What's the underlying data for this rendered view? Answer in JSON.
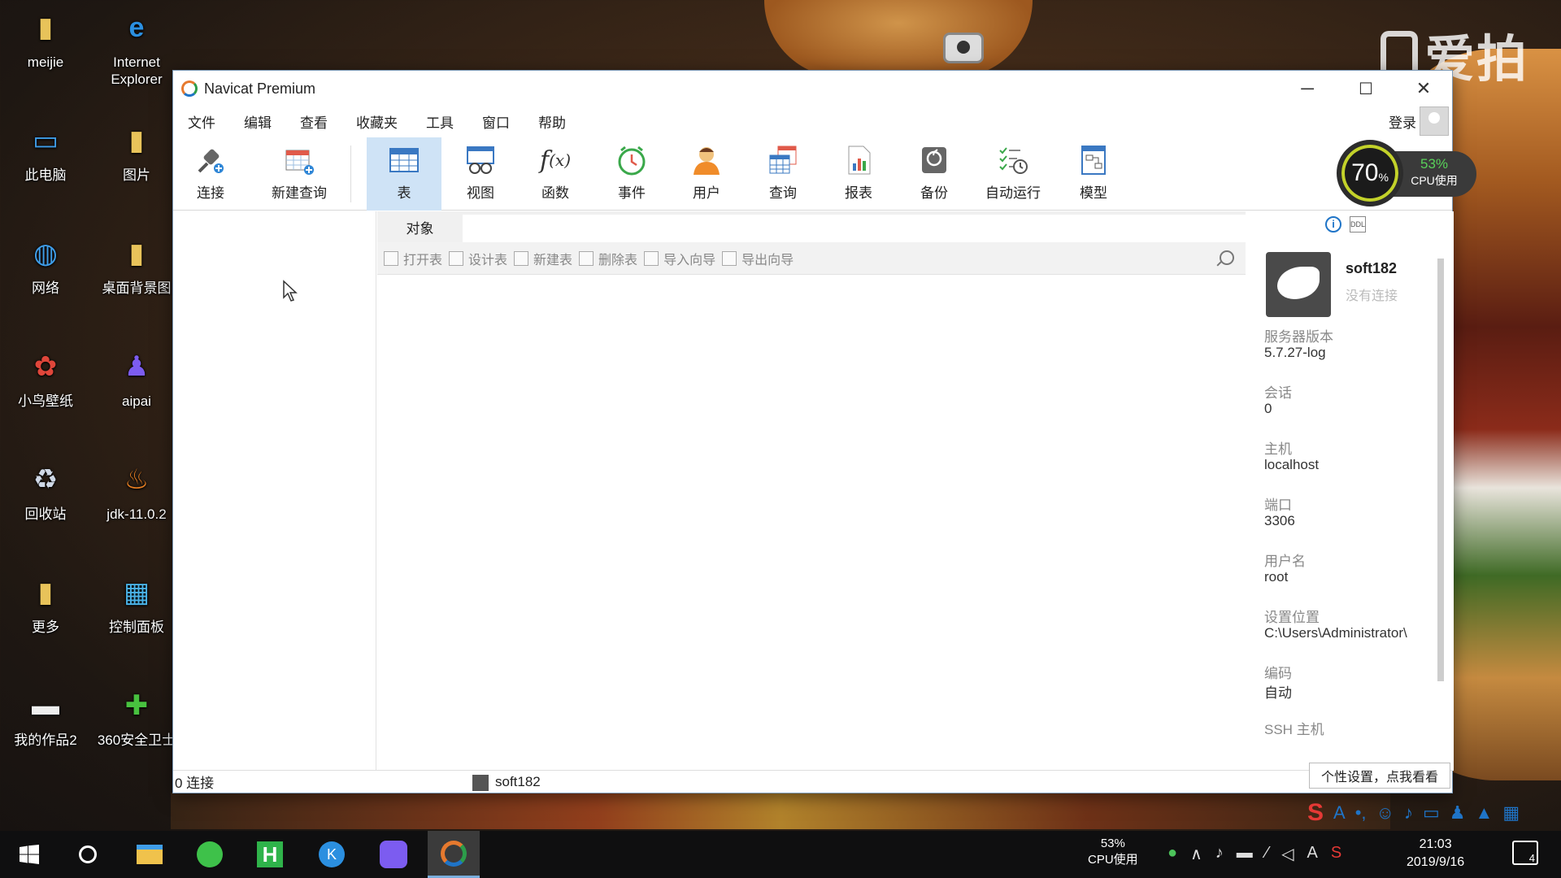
{
  "desktop": {
    "watermark": "爱拍",
    "icons": [
      {
        "label": "meijie",
        "icon": "user-folder-icon",
        "color": "#e8c35a"
      },
      {
        "label": "Internet Explorer",
        "icon": "internet-explorer-icon",
        "color": "#2b8fe0"
      },
      {
        "label": "此电脑",
        "icon": "computer-icon",
        "color": "#3f9de8"
      },
      {
        "label": "图片",
        "icon": "pictures-folder-icon",
        "color": "#e8c35a"
      },
      {
        "label": "网络",
        "icon": "network-icon",
        "color": "#3f9de8"
      },
      {
        "label": "桌面背景图",
        "icon": "wallpaper-folder-icon",
        "color": "#e8c35a"
      },
      {
        "label": "小鸟壁纸",
        "icon": "bird-wallpaper-icon",
        "color": "#e0463a"
      },
      {
        "label": "aipai",
        "icon": "aipai-icon",
        "color": "#7c5cf0"
      },
      {
        "label": "回收站",
        "icon": "recycle-bin-icon",
        "color": "#cfd8e6"
      },
      {
        "label": "jdk-11.0.2",
        "icon": "java-icon",
        "color": "#e67e22"
      },
      {
        "label": "更多",
        "icon": "more-folder-icon",
        "color": "#e8c35a"
      },
      {
        "label": "控制面板",
        "icon": "control-panel-icon",
        "color": "#4ab3e8"
      },
      {
        "label": "我的作品2",
        "icon": "works-icon",
        "color": "#eeeeee"
      },
      {
        "label": "360安全卫士",
        "icon": "360-security-icon",
        "color": "#48c13f"
      }
    ]
  },
  "window": {
    "title": "Navicat Premium",
    "controls": {
      "minimize": "─",
      "maximize": "☐",
      "close": "✕"
    },
    "menu": [
      "文件",
      "编辑",
      "查看",
      "收藏夹",
      "工具",
      "窗口",
      "帮助"
    ],
    "login": "登录",
    "toolbar": [
      {
        "label": "连接",
        "icon": "plug-icon"
      },
      {
        "label": "新建查询",
        "icon": "new-query-icon"
      },
      {
        "label": "表",
        "icon": "table-icon",
        "active": true
      },
      {
        "label": "视图",
        "icon": "view-icon"
      },
      {
        "label": "函数",
        "icon": "function-icon"
      },
      {
        "label": "事件",
        "icon": "clock-icon"
      },
      {
        "label": "用户",
        "icon": "user-icon"
      },
      {
        "label": "查询",
        "icon": "query-icon"
      },
      {
        "label": "报表",
        "icon": "report-icon"
      },
      {
        "label": "备份",
        "icon": "backup-icon"
      },
      {
        "label": "自动运行",
        "icon": "schedule-icon"
      },
      {
        "label": "模型",
        "icon": "model-icon"
      }
    ],
    "object_tab": "对象",
    "object_actions": [
      "打开表",
      "设计表",
      "新建表",
      "删除表",
      "导入向导",
      "导出向导"
    ],
    "connection": {
      "name": "soft182",
      "state": "没有连接",
      "properties": [
        {
          "label": "服务器版本",
          "value": "5.7.27-log"
        },
        {
          "label": "会话",
          "value": "0"
        },
        {
          "label": "主机",
          "value": "localhost"
        },
        {
          "label": "端口",
          "value": "3306"
        },
        {
          "label": "用户名",
          "value": "root"
        },
        {
          "label": "设置位置",
          "value": "C:\\Users\\Administrator\\"
        },
        {
          "label": "编码",
          "value": "自动"
        },
        {
          "label": "SSH 主机",
          "value": ""
        }
      ]
    },
    "status": {
      "connections": "0 连接",
      "current": "soft182"
    }
  },
  "cpu_widget": {
    "ring_value": "70",
    "ring_unit": "%",
    "cpu_percent": "53%",
    "cpu_label": "CPU使用"
  },
  "ime": {
    "tooltip": "个性设置，点我看看"
  },
  "taskbar": {
    "cpu_percent": "53%",
    "cpu_label": "CPU使用",
    "time": "21:03",
    "date": "2019/9/16",
    "notifications": "4",
    "input_mode": "A"
  }
}
